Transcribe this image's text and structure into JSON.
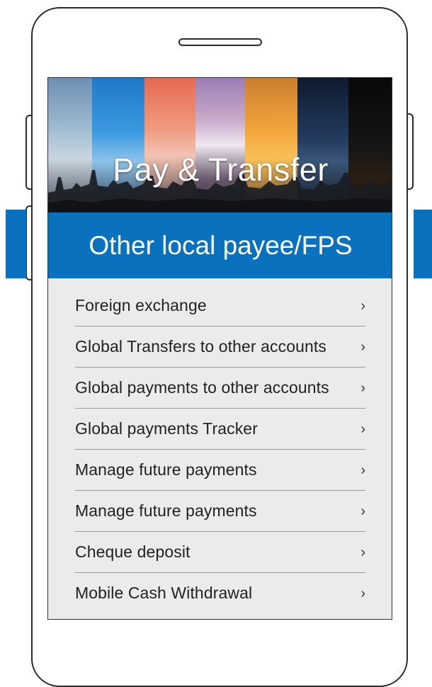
{
  "header": {
    "title": "Pay & Transfer",
    "subtitle": "Other local payee/FPS"
  },
  "menu": {
    "items": [
      {
        "label": "Foreign exchange",
        "icon": "chevron-right-icon",
        "glyph": "›"
      },
      {
        "label": "Global Transfers to other accounts",
        "icon": "chevron-right-icon",
        "glyph": "›"
      },
      {
        "label": "Global payments to other accounts",
        "icon": "chevron-right-icon",
        "glyph": "›"
      },
      {
        "label": "Global payments Tracker",
        "icon": "chevron-right-icon",
        "glyph": "›"
      },
      {
        "label": "Manage future payments",
        "icon": "chevron-right-icon",
        "glyph": "›"
      },
      {
        "label": "Manage future payments",
        "icon": "chevron-right-icon",
        "glyph": "›"
      },
      {
        "label": "Cheque deposit",
        "icon": "chevron-right-icon",
        "glyph": "›"
      },
      {
        "label": "Mobile Cash Withdrawal",
        "icon": "chevron-right-icon",
        "glyph": "›"
      }
    ]
  },
  "colors": {
    "accent_blue": "#0a71be",
    "menu_background": "#ebebeb",
    "divider": "#9c9c9c",
    "text": "#222222"
  }
}
